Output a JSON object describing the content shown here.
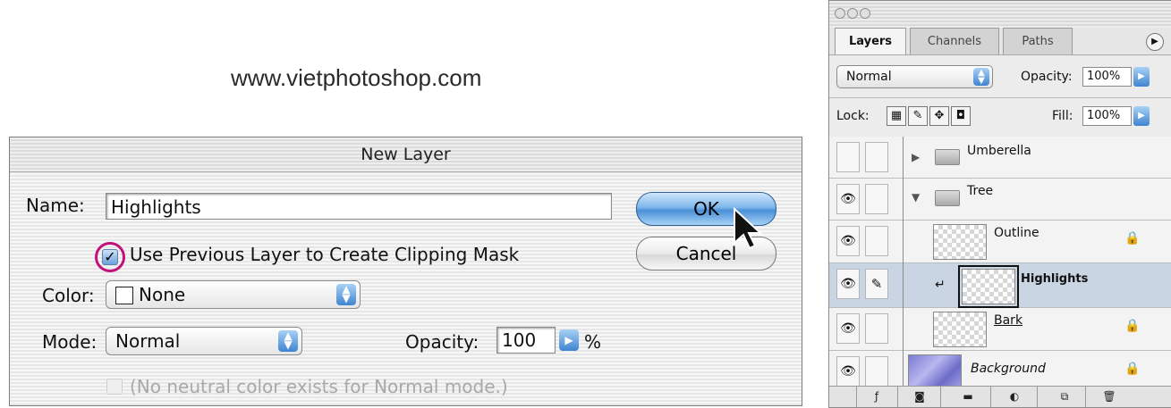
{
  "watermark": "www.vietphotoshop.com",
  "dialog": {
    "title": "New Layer",
    "name_label": "Name:",
    "name_value": "Highlights",
    "clipping_label": "Use Previous Layer to Create Clipping Mask",
    "clipping_checked": true,
    "color_label": "Color:",
    "color_value": "None",
    "mode_label": "Mode:",
    "mode_value": "Normal",
    "opacity_label": "Opacity:",
    "opacity_value": "100",
    "percent_sign": "%",
    "neutral_label": "(No neutral color exists for Normal mode.)",
    "ok_label": "OK",
    "cancel_label": "Cancel",
    "highlight_color": "#c2127a"
  },
  "palette": {
    "tabs": [
      "Layers",
      "Channels",
      "Paths"
    ],
    "active_tab": "Layers",
    "blend_mode": "Normal",
    "opacity_label": "Opacity:",
    "opacity_value": "100%",
    "lock_label": "Lock:",
    "fill_label": "Fill:",
    "fill_value": "100%",
    "layers": [
      {
        "name": "Umberella",
        "type": "group",
        "expanded": false,
        "visible": false
      },
      {
        "name": "Tree",
        "type": "group",
        "expanded": true,
        "visible": true
      },
      {
        "name": "Outline",
        "type": "layer",
        "visible": true,
        "locked": true
      },
      {
        "name": "Highlights",
        "type": "layer",
        "visible": true,
        "clipped": true,
        "selected": true
      },
      {
        "name": "Bark",
        "type": "layer",
        "visible": true,
        "locked": true
      },
      {
        "name": "Background",
        "type": "layer",
        "visible": true,
        "locked": true
      }
    ],
    "bottom_icons": [
      "layer-style-icon",
      "add-mask-icon",
      "new-group-icon",
      "adjustment-layer-icon",
      "new-layer-icon",
      "trash-icon"
    ]
  }
}
